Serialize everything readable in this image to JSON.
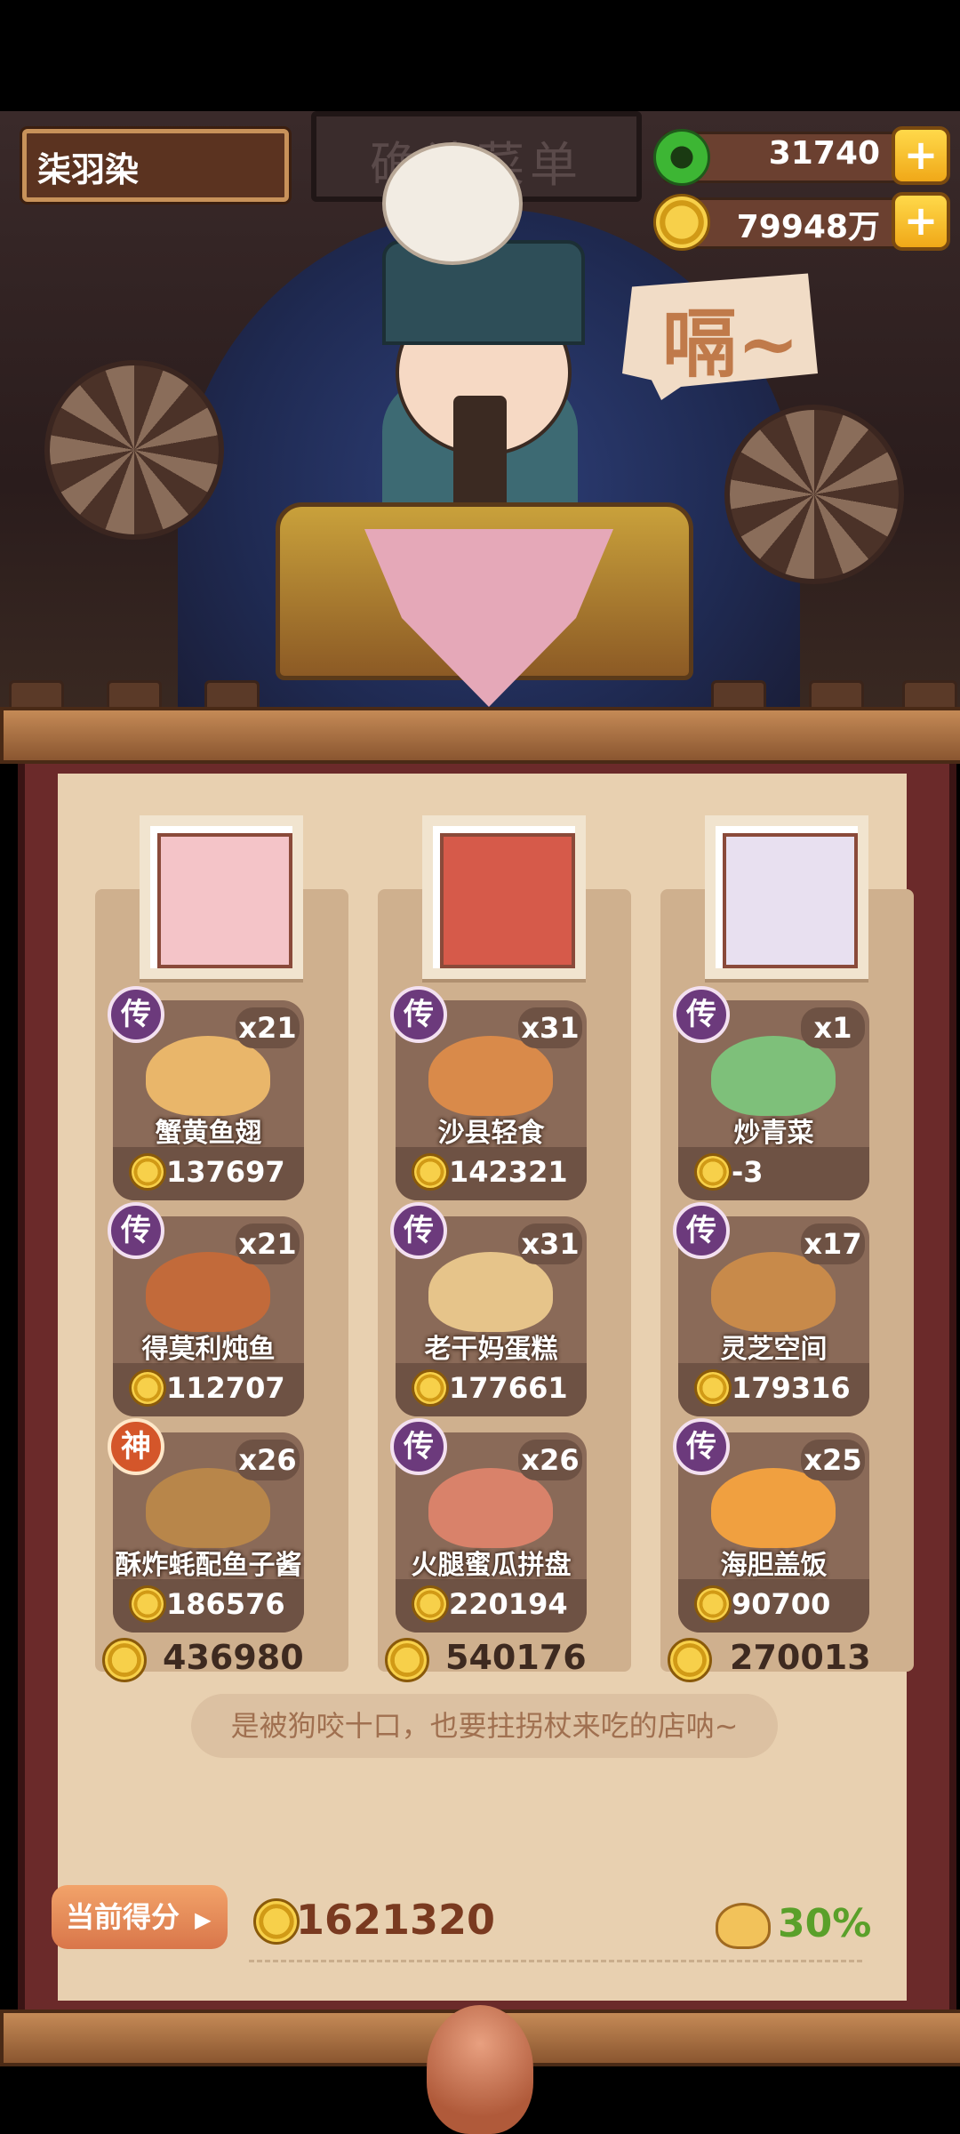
{
  "hud": {
    "player_name": "柒羽染",
    "jade": "31740",
    "coins": "79948万",
    "plus": "+"
  },
  "scene": {
    "sign_text": "确认菜单",
    "speech": "嗝~"
  },
  "columns": [
    {
      "dishes": [
        {
          "rarity": "传",
          "qty": "x21",
          "name": "蟹黄鱼翅",
          "value": "137697"
        },
        {
          "rarity": "传",
          "qty": "x21",
          "name": "得莫利炖鱼",
          "value": "112707"
        },
        {
          "rarity": "神",
          "qty": "x26",
          "name": "酥炸蚝配鱼子酱",
          "value": "186576"
        }
      ],
      "total": "436980"
    },
    {
      "dishes": [
        {
          "rarity": "传",
          "qty": "x31",
          "name": "沙县轻食",
          "value": "142321"
        },
        {
          "rarity": "传",
          "qty": "x31",
          "name": "老干妈蛋糕",
          "value": "177661"
        },
        {
          "rarity": "传",
          "qty": "x26",
          "name": "火腿蜜瓜拼盘",
          "value": "220194"
        }
      ],
      "total": "540176"
    },
    {
      "dishes": [
        {
          "rarity": "传",
          "qty": "x1",
          "name": "炒青菜",
          "value": "-3"
        },
        {
          "rarity": "传",
          "qty": "x17",
          "name": "灵芝空间",
          "value": "179316"
        },
        {
          "rarity": "传",
          "qty": "x25",
          "name": "海胆盖饭",
          "value": "90700"
        }
      ],
      "total": "270013"
    }
  ],
  "quote": "是被狗咬十口，也要拄拐杖来吃的店呐~",
  "score": {
    "label": "当前得分",
    "value": "1621320",
    "percent": "30%"
  },
  "colors": {
    "rare_purple": "#6c3a7c",
    "god_orange": "#d4562a",
    "percent_green": "#5aa02a"
  }
}
